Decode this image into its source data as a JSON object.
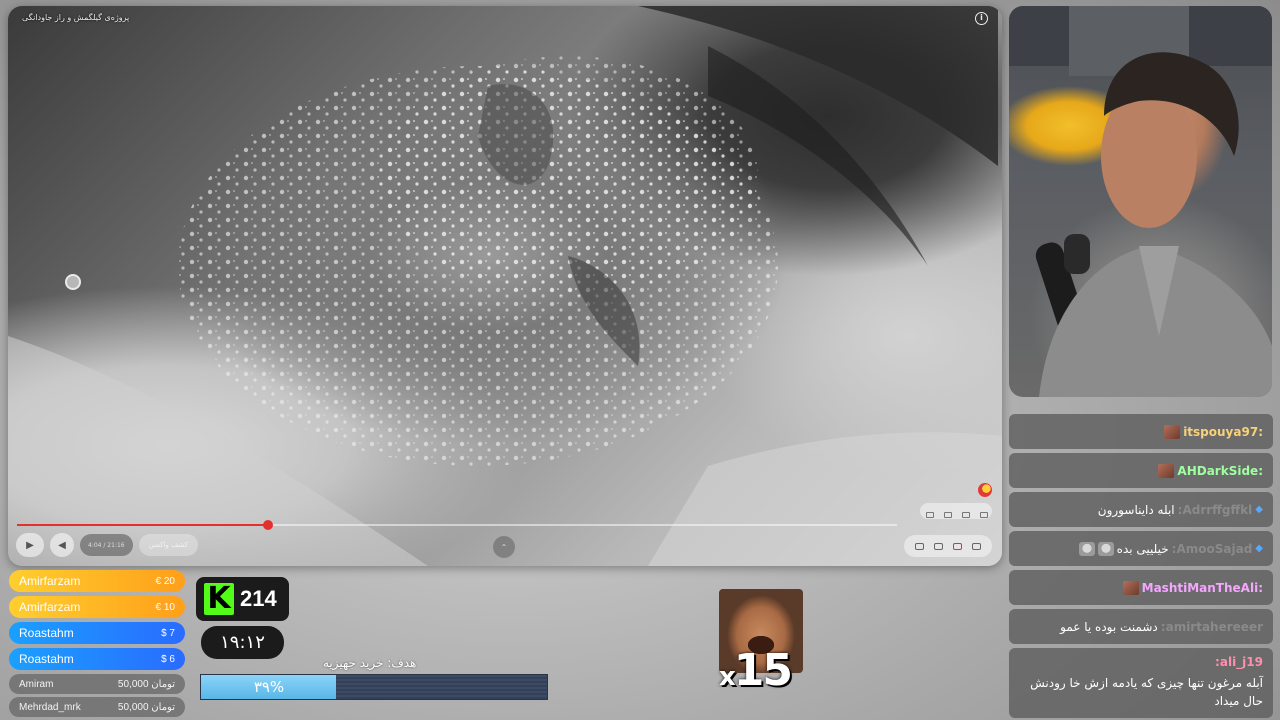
{
  "player": {
    "caption": "پروژه‌ی گیلگمش و راز جاودانگی",
    "time": "4:04 / 21:16",
    "chapter": "کشف واکسن",
    "progress_fraction": 0.285,
    "colors": {
      "progress": "#e3302f"
    }
  },
  "chat": [
    {
      "user": ":itspouya97",
      "text": "",
      "user_color": "#f6d27a",
      "emote": "box"
    },
    {
      "user": ":AHDarkSide",
      "text": "",
      "user_color": "#9effa0",
      "emote": "box"
    },
    {
      "user": "Adrrffgffkl:",
      "text": "ابله دایناسورون",
      "user_color": "#8a8a8a",
      "badge": "diamond"
    },
    {
      "user": "AmooSajad:",
      "text": "خیلییی بده",
      "user_color": "#8a8a8a",
      "badge": "diamond",
      "emote": "cat"
    },
    {
      "user": ":MashtiManTheAli",
      "text": "",
      "user_color": "#f5a6ff",
      "emote": "box"
    },
    {
      "user": "amirtahereeer:",
      "text": "دشمنت بوده یا عمو",
      "user_color": "#8a8a8a"
    },
    {
      "user": "ali_j19:",
      "text": "آبله مرغون تنها چیزی که یادمه ازش خا رودنش حال میداد",
      "user_color": "#ff8fb0"
    }
  ],
  "donations": [
    {
      "name": "Amirfarzam",
      "amount": "€ 20",
      "tier": "gold"
    },
    {
      "name": "Amirfarzam",
      "amount": "€ 10",
      "tier": "gold"
    },
    {
      "name": "Roastahm",
      "amount": "$ 7",
      "tier": "blue"
    },
    {
      "name": "Roastahm",
      "amount": "$ 6",
      "tier": "blue"
    },
    {
      "name": "Amiram",
      "amount": "50,000 تومان",
      "tier": "gray"
    },
    {
      "name": "Mehrdad_mrk",
      "amount": "50,000 تومان",
      "tier": "gray"
    }
  ],
  "viewers": {
    "count": "214",
    "logo": "K"
  },
  "clock": "۱۹:۱۲",
  "goal": {
    "label": "هدف: خرید جهیزیه",
    "percent_text": "۳۹%",
    "fraction": 0.39
  },
  "emote_combo": {
    "count": "15",
    "prefix": "x"
  }
}
